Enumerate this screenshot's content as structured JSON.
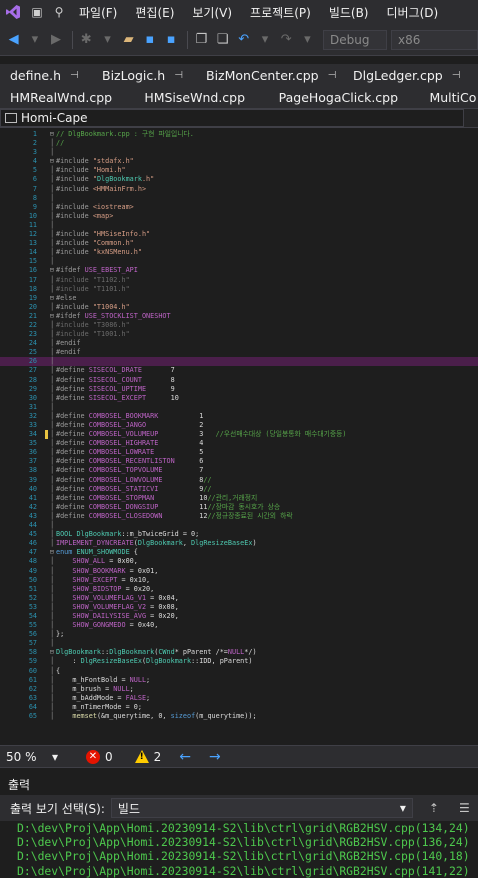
{
  "menu": {
    "items": [
      "파일(F)",
      "편집(E)",
      "보기(V)",
      "프로젝트(P)",
      "빌드(B)",
      "디버그(D)"
    ]
  },
  "toolbar": {
    "config": "Debug",
    "platform": "x86"
  },
  "tabs_row1": [
    "define.h",
    "BizLogic.h",
    "BizMonCenter.cpp",
    "DlgLedger.cpp"
  ],
  "tabs_row2": [
    "HMRealWnd.cpp",
    "HMSiseWnd.cpp",
    "PageHogaClick.cpp",
    "MultiCo"
  ],
  "nav": {
    "project": "Homi-Cape"
  },
  "code": {
    "lines": [
      [
        "1",
        "// DlgBookmark.cpp : 구현 파일입니다."
      ],
      [
        "2",
        "//"
      ],
      [
        "3",
        ""
      ],
      [
        "4",
        "#include \"stdafx.h\""
      ],
      [
        "5",
        "#include \"Homi.h\""
      ],
      [
        "6",
        "#include \"DlgBookmark.h\""
      ],
      [
        "7",
        "#include <HMMainFrm.h>"
      ],
      [
        "8",
        ""
      ],
      [
        "9",
        "#include <iostream>"
      ],
      [
        "10",
        "#include <map>"
      ],
      [
        "11",
        ""
      ],
      [
        "12",
        "#include \"HMSiseInfo.h\""
      ],
      [
        "13",
        "#include \"Common.h\""
      ],
      [
        "14",
        "#include \"kxNSMenu.h\""
      ],
      [
        "15",
        ""
      ],
      [
        "16",
        "#ifdef USE_EBEST_API"
      ],
      [
        "17",
        "#include \"T1102.h\""
      ],
      [
        "18",
        "#include \"T1101.h\""
      ],
      [
        "19",
        "#else"
      ],
      [
        "20",
        "#include \"T1004.h\""
      ],
      [
        "21",
        "#ifdef USE_STOCKLIST_ONESHOT"
      ],
      [
        "22",
        "#include \"T3086.h\""
      ],
      [
        "23",
        "#include \"T1001.h\""
      ],
      [
        "24",
        "#endif"
      ],
      [
        "25",
        "#endif"
      ],
      [
        "26",
        ""
      ],
      [
        "27",
        "#define SISECOL_DRATE       7"
      ],
      [
        "28",
        "#define SISECOL_COUNT       8"
      ],
      [
        "29",
        "#define SISECOL_UPTIME      9"
      ],
      [
        "30",
        "#define SISECOL_EXCEPT      10"
      ],
      [
        "31",
        ""
      ],
      [
        "32",
        "#define COMBOSEL_BOOKMARK          1"
      ],
      [
        "33",
        "#define COMBOSEL_JANGO             2"
      ],
      [
        "34",
        "#define COMBOSEL_VOLUMEUP          3   //우선매수대상 (당일봉통화 매수대기중등)"
      ],
      [
        "35",
        "#define COMBOSEL_HIGHRATE          4"
      ],
      [
        "36",
        "#define COMBOSEL_LOWRATE           5"
      ],
      [
        "37",
        "#define COMBOSEL_RECENTLISTON      6"
      ],
      [
        "38",
        "#define COMBOSEL_TOPVOLUME         7"
      ],
      [
        "39",
        "#define COMBOSEL_LOWVOLUME         8//"
      ],
      [
        "40",
        "#define COMBOSEL_STATICVI          9//"
      ],
      [
        "41",
        "#define COMBOSEL_STOPMAN           10//관리,거래정지"
      ],
      [
        "42",
        "#define COMBOSEL_DONGSIUP          11//장마감 동시호가 상승"
      ],
      [
        "43",
        "#define COMBOSEL_CLOSEDOWN         12//정규장종료된 시간외 하락"
      ],
      [
        "44",
        ""
      ],
      [
        "45",
        "BOOL DlgBookmark::m_bTwiceGrid = 0;"
      ],
      [
        "46",
        "IMPLEMENT_DYNCREATE(DlgBookmark, DlgResizeBaseEx)"
      ],
      [
        "47",
        "enum ENUM_SHOWMODE {"
      ],
      [
        "48",
        "    SHOW_ALL = 0x00,"
      ],
      [
        "49",
        "    SHOW_BOOKMARK = 0x01,"
      ],
      [
        "50",
        "    SHOW_EXCEPT = 0x10,"
      ],
      [
        "51",
        "    SHOW_BIDSTOP = 0x20,"
      ],
      [
        "52",
        "    SHOW_VOLUMEFLAG_V1 = 0x04,"
      ],
      [
        "53",
        "    SHOW_VOLUMEFLAG_V2 = 0x08,"
      ],
      [
        "54",
        "    SHOW_DAILYSISE_AVG = 0x20,"
      ],
      [
        "55",
        "    SHOW_GONGMEDO = 0x40,"
      ],
      [
        "56",
        "};"
      ],
      [
        "57",
        ""
      ],
      [
        "58",
        "DlgBookmark::DlgBookmark(CWnd* pParent /*=NULL*/)"
      ],
      [
        "59",
        "    : DlgResizeBaseEx(DlgBookmark::IDD, pParent)"
      ],
      [
        "60",
        "{"
      ],
      [
        "61",
        "    m_hFontBold = NULL;"
      ],
      [
        "62",
        "    m_brush = NULL;"
      ],
      [
        "63",
        "    m_bAddMode = FALSE;"
      ],
      [
        "64",
        "    m_nTimerMode = 0;"
      ],
      [
        "65",
        "    memset(&m_querytime, 0, sizeof(m_querytime));"
      ]
    ]
  },
  "status": {
    "zoom": "50 %",
    "errors": "0",
    "warnings": "2"
  },
  "output": {
    "title": "출력",
    "source_label": "출력 보기 선택(S):",
    "source_value": "빌드",
    "lines": [
      "D:\\dev\\Proj\\App\\Homi.20230914-S2\\lib\\ctrl\\grid\\RGB2HSV.cpp(134,24)",
      "D:\\dev\\Proj\\App\\Homi.20230914-S2\\lib\\ctrl\\grid\\RGB2HSV.cpp(136,24)",
      "D:\\dev\\Proj\\App\\Homi.20230914-S2\\lib\\ctrl\\grid\\RGB2HSV.cpp(140,18)",
      "D:\\dev\\Proj\\App\\Homi.20230914-S2\\lib\\ctrl\\grid\\RGB2HSV.cpp(141,22)"
    ]
  },
  "colors": {
    "background": "#1e1e1e",
    "chrome": "#2d2d30",
    "line_number": "#2b91af",
    "comment": "#57a64a",
    "string": "#d69d85",
    "macro": "#bd63c5",
    "keyword": "#569cd6",
    "type": "#4ec9b0",
    "output_text": "#4ec94e",
    "highlight_line": "#4b1f4b"
  }
}
